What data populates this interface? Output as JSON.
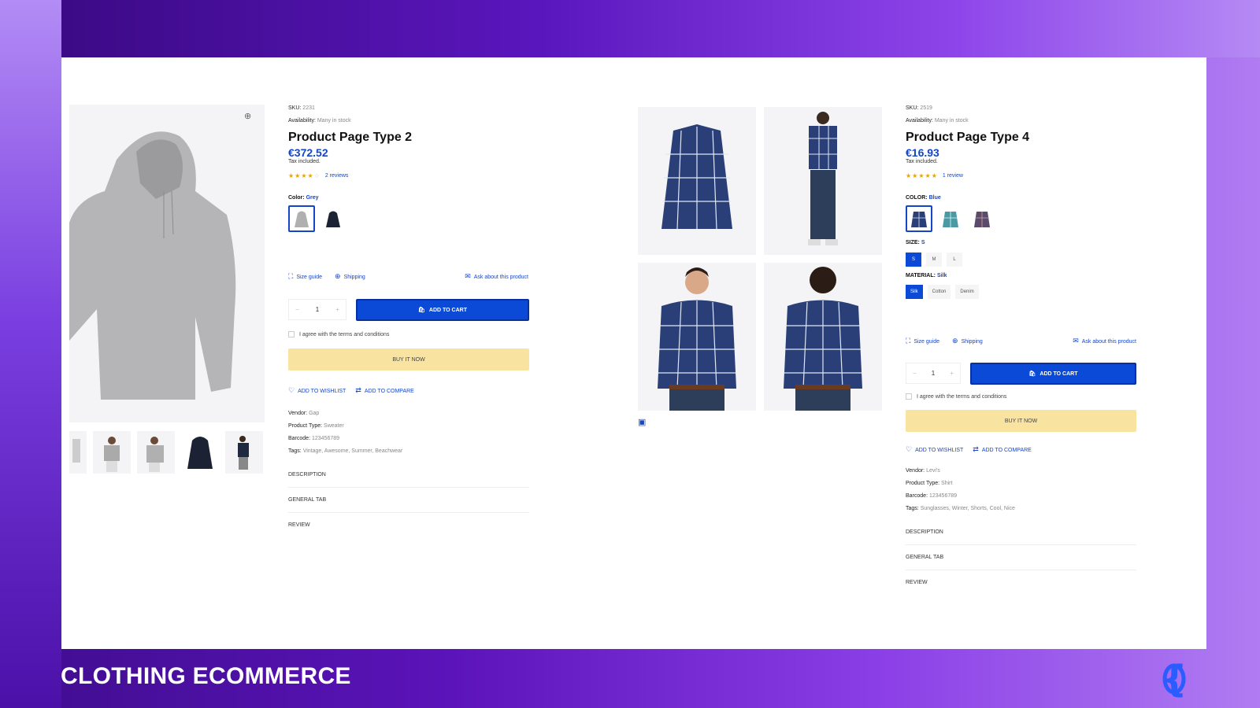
{
  "footer": {
    "title": "CLOTHING ECOMMERCE",
    "logo_icon": "curly-brace-o-logo-icon"
  },
  "colors": {
    "accent": "#0a4ad6",
    "price": "#1546c7",
    "buy_now": "#f8e3a1",
    "stars": "#e6a400"
  },
  "product_left": {
    "sku_label": "SKU:",
    "sku": "2231",
    "availability_label": "Availability:",
    "availability": "Many in stock",
    "title": "Product Page Type 2",
    "price": "€372.52",
    "tax": "Tax included.",
    "rating": 4,
    "reviews": "2 reviews",
    "color_label": "Color:",
    "color_value": "Grey",
    "links": {
      "size_guide": "Size guide",
      "shipping": "Shipping",
      "ask": "Ask about this product"
    },
    "quantity": "1",
    "add_to_cart": "ADD TO CART",
    "terms": "I agree with the terms and conditions",
    "buy_now": "BUY IT NOW",
    "wishlist": "ADD TO WISHLIST",
    "compare": "ADD TO COMPARE",
    "vendor_label": "Vendor:",
    "vendor": "Gap",
    "type_label": "Product Type:",
    "type": "Sweater",
    "barcode_label": "Barcode:",
    "barcode": "123456789",
    "tags_label": "Tags:",
    "tags": "Vintage, Awesome, Summer, Beachwear",
    "tabs": [
      "DESCRIPTION",
      "GENERAL TAB",
      "REVIEW"
    ]
  },
  "product_right": {
    "sku_label": "SKU:",
    "sku": "2519",
    "availability_label": "Availability:",
    "availability": "Many in stock",
    "title": "Product Page Type 4",
    "price": "€16.93",
    "tax": "Tax included.",
    "rating": 5,
    "reviews": "1 review",
    "color_label": "COLOR:",
    "color_value": "Blue",
    "size_label": "SIZE:",
    "size_value": "S",
    "sizes": [
      "S",
      "M",
      "L"
    ],
    "material_label": "MATERIAL:",
    "material_value": "Silk",
    "materials": [
      "Silk",
      "Cotton",
      "Denim"
    ],
    "links": {
      "size_guide": "Size guide",
      "shipping": "Shipping",
      "ask": "Ask about this product"
    },
    "quantity": "1",
    "add_to_cart": "ADD TO CART",
    "terms": "I agree with the terms and conditions",
    "buy_now": "BUY IT NOW",
    "wishlist": "ADD TO WISHLIST",
    "compare": "ADD TO COMPARE",
    "vendor_label": "Vendor:",
    "vendor": "Levi's",
    "type_label": "Product Type:",
    "type": "Shirt",
    "barcode_label": "Barcode:",
    "barcode": "123456789",
    "tags_label": "Tags:",
    "tags": "Sunglasses, Winter, Shorts, Cool, Nice",
    "tabs": [
      "DESCRIPTION",
      "GENERAL TAB",
      "REVIEW"
    ]
  }
}
